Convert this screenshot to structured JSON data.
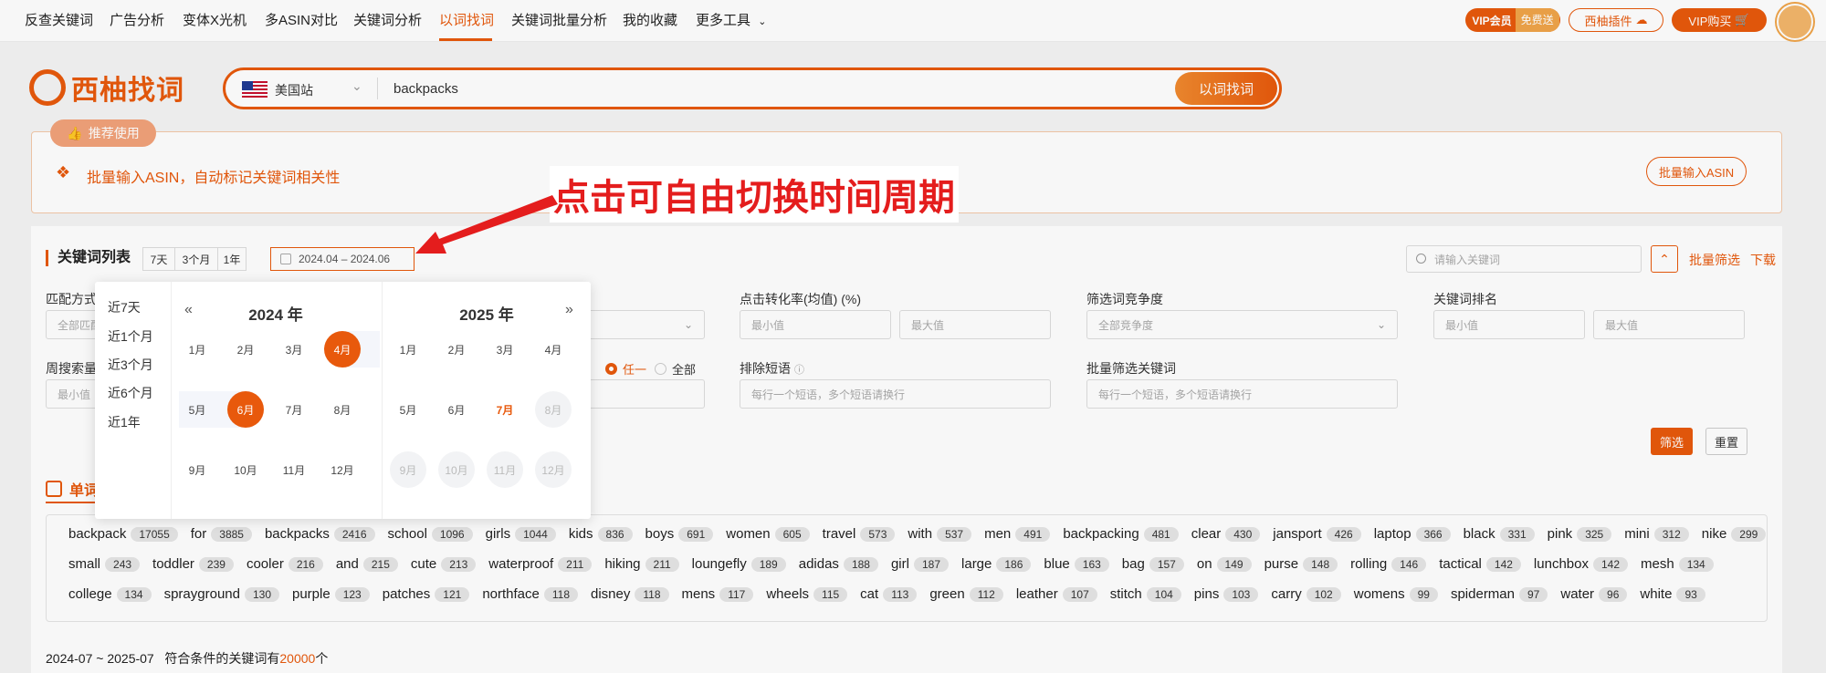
{
  "nav": {
    "items": [
      "反查关键词",
      "广告分析",
      "变体X光机",
      "多ASIN对比",
      "关键词分析",
      "以词找词",
      "关键词批量分析",
      "我的收藏",
      "更多工具"
    ],
    "vip_label": "VIP会员",
    "vip_free": "免费送",
    "plugin_label": "西柚插件",
    "buy_label": "VIP购买"
  },
  "logo": {
    "text": "西柚找词"
  },
  "search": {
    "site": "美国站",
    "query": "backpacks",
    "button": "以词找词"
  },
  "promo": {
    "tag": "推荐使用",
    "text": "批量输入ASIN，自动标记关键词相关性",
    "button": "批量输入ASIN"
  },
  "annotation": "点击可自由切换时间周期",
  "panel": {
    "title": "关键词列表",
    "ranges": [
      "7天",
      "3个月",
      "1年"
    ],
    "date_range": "2024.04 – 2024.06",
    "search_placeholder": "请输入关键词",
    "batch_filter": "批量筛选",
    "download": "下载",
    "filters": {
      "match_label": "匹配方式",
      "match_value": "全部匹配",
      "weekly_label": "周搜索量",
      "weekly_min": "最小值",
      "cvr_label": "点击转化率(均值) (%)",
      "min": "最小值",
      "max": "最大值",
      "competition_label": "筛选词竞争度",
      "competition_value": "全部竞争度",
      "rank_label": "关键词排名",
      "radio_any": "任一",
      "radio_all": "全部",
      "exclude_label": "排除短语",
      "exclude_placeholder": "每行一个短语，多个短语请换行",
      "batch_kw_label": "批量筛选关键词",
      "batch_kw_placeholder": "每行一个短语，多个短语请换行"
    },
    "filter_button": "筛选",
    "reset_button": "重置",
    "tab_single": "单词",
    "summary_prefix": "2024-07 ~ 2025-07   符合条件的关键词有",
    "summary_count": "20000",
    "summary_suffix": "个"
  },
  "word_cloud": {
    "row1": [
      [
        "backpack",
        "17055"
      ],
      [
        "for",
        "3885"
      ],
      [
        "backpacks",
        "2416"
      ],
      [
        "school",
        "1096"
      ],
      [
        "girls",
        "1044"
      ],
      [
        "kids",
        "836"
      ],
      [
        "boys",
        "691"
      ],
      [
        "women",
        "605"
      ],
      [
        "travel",
        "573"
      ],
      [
        "with",
        "537"
      ],
      [
        "men",
        "491"
      ],
      [
        "backpacking",
        "481"
      ],
      [
        "clear",
        "430"
      ],
      [
        "jansport",
        "426"
      ],
      [
        "laptop",
        "366"
      ],
      [
        "black",
        "331"
      ],
      [
        "pink",
        "325"
      ],
      [
        "mini",
        "312"
      ],
      [
        "nike",
        "299"
      ]
    ],
    "row2": [
      [
        "small",
        "243"
      ],
      [
        "toddler",
        "239"
      ],
      [
        "cooler",
        "216"
      ],
      [
        "and",
        "215"
      ],
      [
        "cute",
        "213"
      ],
      [
        "waterproof",
        "211"
      ],
      [
        "hiking",
        "211"
      ],
      [
        "loungefly",
        "189"
      ],
      [
        "adidas",
        "188"
      ],
      [
        "girl",
        "187"
      ],
      [
        "large",
        "186"
      ],
      [
        "blue",
        "163"
      ],
      [
        "bag",
        "157"
      ],
      [
        "on",
        "149"
      ],
      [
        "purse",
        "148"
      ],
      [
        "rolling",
        "146"
      ],
      [
        "tactical",
        "142"
      ],
      [
        "lunchbox",
        "142"
      ],
      [
        "mesh",
        "134"
      ]
    ],
    "row3": [
      [
        "college",
        "134"
      ],
      [
        "sprayground",
        "130"
      ],
      [
        "purple",
        "123"
      ],
      [
        "patches",
        "121"
      ],
      [
        "northface",
        "118"
      ],
      [
        "disney",
        "118"
      ],
      [
        "mens",
        "117"
      ],
      [
        "wheels",
        "115"
      ],
      [
        "cat",
        "113"
      ],
      [
        "green",
        "112"
      ],
      [
        "leather",
        "107"
      ],
      [
        "stitch",
        "104"
      ],
      [
        "pins",
        "103"
      ],
      [
        "carry",
        "102"
      ],
      [
        "womens",
        "99"
      ],
      [
        "spiderman",
        "97"
      ],
      [
        "water",
        "96"
      ],
      [
        "white",
        "93"
      ]
    ]
  },
  "calendar": {
    "quick": [
      "近7天",
      "近1个月",
      "近3个月",
      "近6个月",
      "近1年"
    ],
    "left_year": "2024 年",
    "right_year": "2025 年",
    "months": [
      "1月",
      "2月",
      "3月",
      "4月",
      "5月",
      "6月",
      "7月",
      "8月",
      "9月",
      "10月",
      "11月",
      "12月"
    ],
    "prev_icon": "«",
    "next_icon": "»"
  }
}
